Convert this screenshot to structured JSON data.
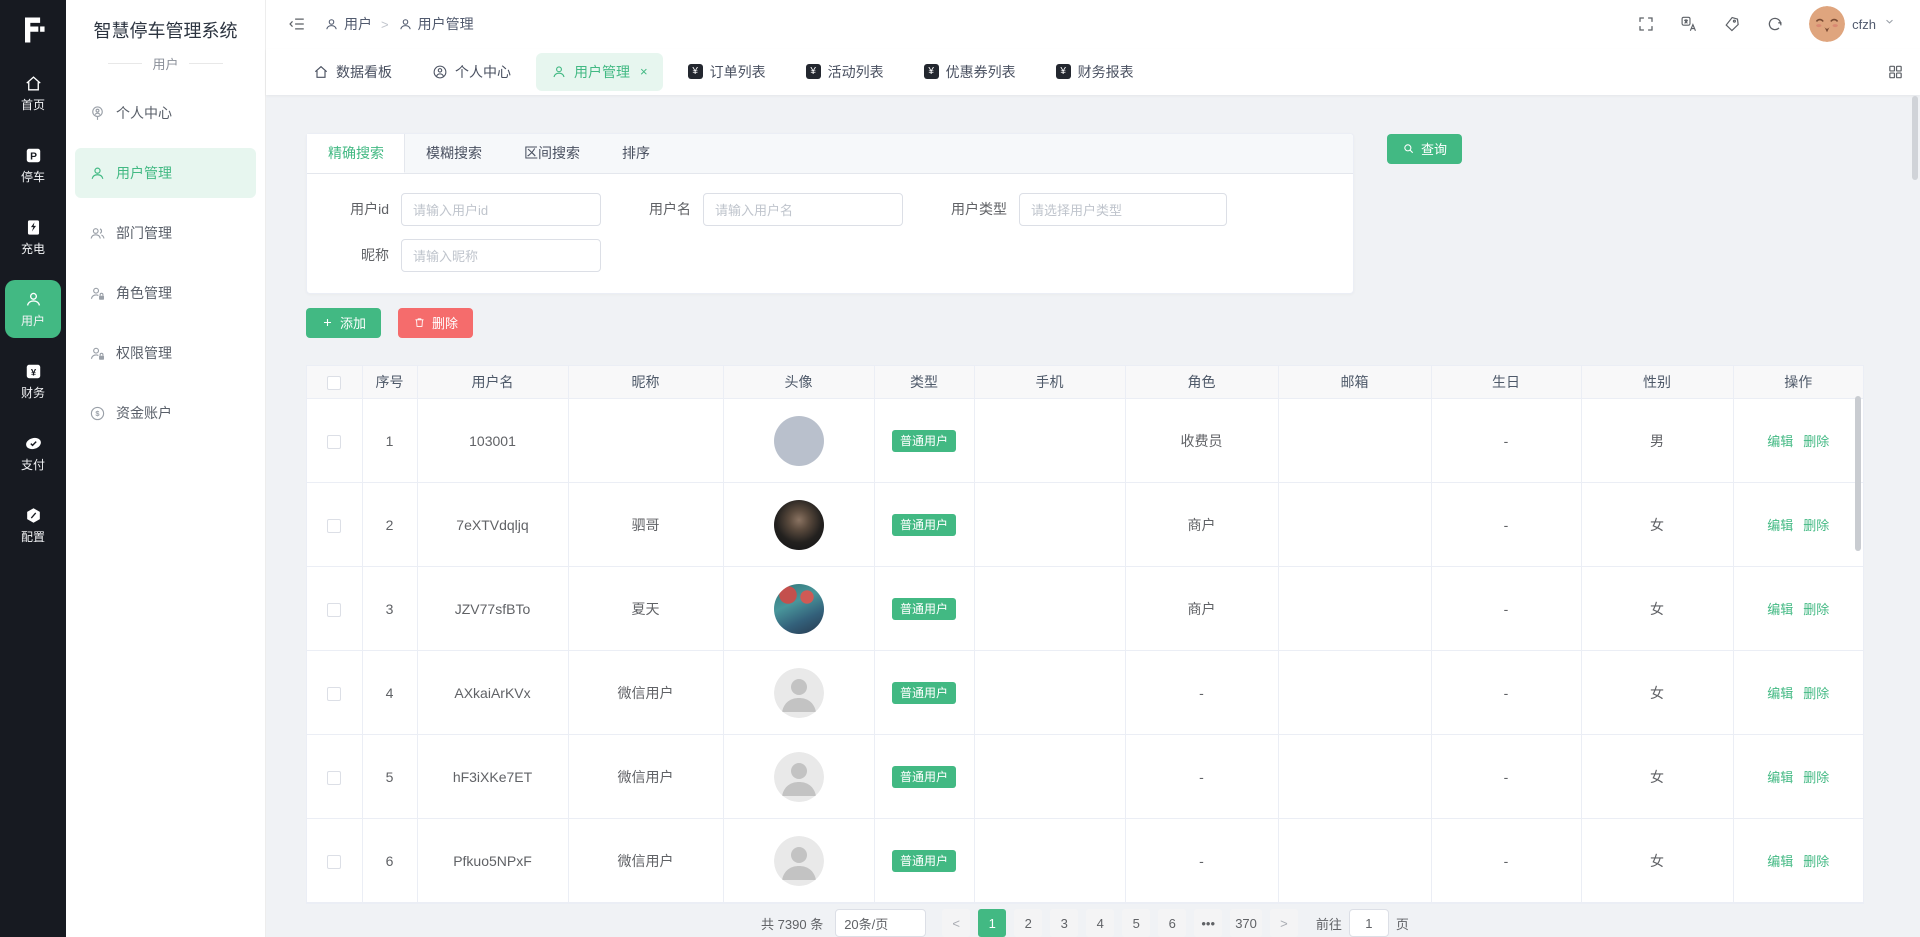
{
  "app": {
    "title": "智慧停车管理系统",
    "module_label": "用户"
  },
  "rail": {
    "items": [
      {
        "key": "home",
        "label": "首页",
        "active": false
      },
      {
        "key": "parking",
        "label": "停车",
        "active": false
      },
      {
        "key": "charging",
        "label": "充电",
        "active": false
      },
      {
        "key": "user",
        "label": "用户",
        "active": true
      },
      {
        "key": "finance",
        "label": "财务",
        "active": false
      },
      {
        "key": "payment",
        "label": "支付",
        "active": false
      },
      {
        "key": "config",
        "label": "配置",
        "active": false
      }
    ]
  },
  "sidebar": {
    "items": [
      {
        "key": "profile-center",
        "icon": "pin",
        "label": "个人中心",
        "active": false
      },
      {
        "key": "user-management",
        "icon": "user",
        "label": "用户管理",
        "active": true
      },
      {
        "key": "dept-management",
        "icon": "dept",
        "label": "部门管理",
        "active": false
      },
      {
        "key": "role-management",
        "icon": "lock",
        "label": "角色管理",
        "active": false
      },
      {
        "key": "perm-management",
        "icon": "lock",
        "label": "权限管理",
        "active": false
      },
      {
        "key": "fund-account",
        "icon": "fund",
        "label": "资金账户",
        "active": false
      }
    ]
  },
  "header": {
    "breadcrumb": [
      "用户",
      "用户管理"
    ],
    "username": "cfzh"
  },
  "tabs": [
    {
      "key": "dashboard",
      "icon": "home",
      "label": "数据看板",
      "active": false,
      "closable": false
    },
    {
      "key": "profile",
      "icon": "circleperson",
      "label": "个人中心",
      "active": false,
      "closable": false
    },
    {
      "key": "users",
      "icon": "user",
      "label": "用户管理",
      "active": true,
      "closable": true
    },
    {
      "key": "orders",
      "icon": "sq",
      "label": "订单列表",
      "active": false,
      "closable": false
    },
    {
      "key": "activities",
      "icon": "sq",
      "label": "活动列表",
      "active": false,
      "closable": false
    },
    {
      "key": "coupons",
      "icon": "sq",
      "label": "优惠券列表",
      "active": false,
      "closable": false
    },
    {
      "key": "reports",
      "icon": "sq",
      "label": "财务报表",
      "active": false,
      "closable": false
    }
  ],
  "search": {
    "tabs": [
      {
        "key": "exact",
        "label": "精确搜索",
        "active": true
      },
      {
        "key": "fuzzy",
        "label": "模糊搜索",
        "active": false
      },
      {
        "key": "range",
        "label": "区间搜索",
        "active": false
      },
      {
        "key": "sort",
        "label": "排序",
        "active": false
      }
    ],
    "fields": [
      {
        "key": "user-id",
        "label": "用户id",
        "placeholder": "请输入用户id",
        "type": "input",
        "row": 1,
        "wide": false
      },
      {
        "key": "username",
        "label": "用户名",
        "placeholder": "请输入用户名",
        "type": "input",
        "row": 1,
        "wide": false
      },
      {
        "key": "user-type",
        "label": "用户类型",
        "placeholder": "请选择用户类型",
        "type": "select",
        "row": 1,
        "wide": true
      },
      {
        "key": "nickname",
        "label": "昵称",
        "placeholder": "请输入昵称",
        "type": "input",
        "row": 2,
        "wide": false
      }
    ],
    "query_button": "查询"
  },
  "actions": {
    "add": "添加",
    "delete": "删除"
  },
  "table": {
    "columns": [
      "序号",
      "用户名",
      "昵称",
      "头像",
      "类型",
      "手机",
      "角色",
      "邮箱",
      "生日",
      "性别",
      "操作"
    ],
    "edit_label": "编辑",
    "delete_label": "删除",
    "rows": [
      {
        "index": "1",
        "username": "103001",
        "nickname": "",
        "avatar": "plain",
        "type": "普通用户",
        "phone": "",
        "role": "收费员",
        "email": "",
        "birthday": "-",
        "gender": "男"
      },
      {
        "index": "2",
        "username": "7eXTVdqljq",
        "nickname": "驷哥",
        "avatar": "photo-dark",
        "type": "普通用户",
        "phone": "",
        "role": "商户",
        "email": "",
        "birthday": "-",
        "gender": "女"
      },
      {
        "index": "3",
        "username": "JZV77sfBTo",
        "nickname": "夏天",
        "avatar": "photo-festive",
        "type": "普通用户",
        "phone": "",
        "role": "商户",
        "email": "",
        "birthday": "-",
        "gender": "女"
      },
      {
        "index": "4",
        "username": "AXkaiArKVx",
        "nickname": "微信用户",
        "avatar": "default",
        "type": "普通用户",
        "phone": "",
        "role": "-",
        "email": "",
        "birthday": "-",
        "gender": "女"
      },
      {
        "index": "5",
        "username": "hF3iXKe7ET",
        "nickname": "微信用户",
        "avatar": "default",
        "type": "普通用户",
        "phone": "",
        "role": "-",
        "email": "",
        "birthday": "-",
        "gender": "女"
      },
      {
        "index": "6",
        "username": "Pfkuo5NPxF",
        "nickname": "微信用户",
        "avatar": "default",
        "type": "普通用户",
        "phone": "",
        "role": "-",
        "email": "",
        "birthday": "-",
        "gender": "女"
      }
    ]
  },
  "pagination": {
    "total_text": "共 7390 条",
    "page_size": "20条/页",
    "pages": [
      "1",
      "2",
      "3",
      "4",
      "5",
      "6",
      "...",
      "370"
    ],
    "active_page": "1",
    "prev": "<",
    "next": ">",
    "goto_label": "前往",
    "goto_value": "1",
    "page_unit": "页"
  },
  "colors": {
    "accent": "#42b983",
    "danger": "#f56c6c",
    "rail_bg": "#171a21",
    "active_bg": "#e7f6ef"
  }
}
